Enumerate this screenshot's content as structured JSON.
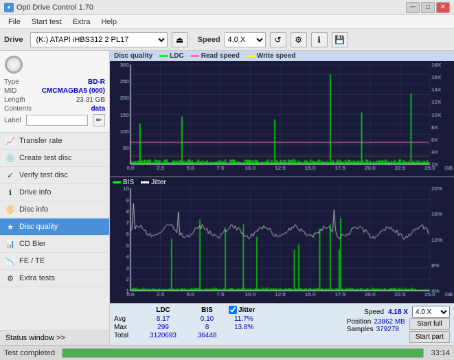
{
  "titlebar": {
    "title": "Opti Drive Control 1.70",
    "icon": "●",
    "minimize": "─",
    "maximize": "□",
    "close": "✕"
  },
  "menubar": {
    "items": [
      "File",
      "Start test",
      "Extra",
      "Help"
    ]
  },
  "toolbar": {
    "drive_label": "Drive",
    "drive_value": "(K:)  ATAPI iHBS312  2 PL17",
    "speed_label": "Speed",
    "speed_value": "4.0 X"
  },
  "sidebar": {
    "disc_type": "BD-R",
    "disc_mid": "CMCMAGBA5 (000)",
    "disc_length": "23.31 GB",
    "disc_contents": "data",
    "disc_label_placeholder": "",
    "nav_items": [
      {
        "id": "transfer-rate",
        "label": "Transfer rate",
        "icon": "📈"
      },
      {
        "id": "create-test-disc",
        "label": "Create test disc",
        "icon": "💿"
      },
      {
        "id": "verify-test-disc",
        "label": "Verify test disc",
        "icon": "✓"
      },
      {
        "id": "drive-info",
        "label": "Drive info",
        "icon": "ℹ"
      },
      {
        "id": "disc-info",
        "label": "Disc info",
        "icon": "📀"
      },
      {
        "id": "disc-quality",
        "label": "Disc quality",
        "icon": "★",
        "active": true
      },
      {
        "id": "cd-bler",
        "label": "CD Bler",
        "icon": "📊"
      },
      {
        "id": "fe-te",
        "label": "FE / TE",
        "icon": "📉"
      },
      {
        "id": "extra-tests",
        "label": "Extra tests",
        "icon": "⚙"
      }
    ],
    "status_window": "Status window >>"
  },
  "chart1": {
    "title": "Disc quality",
    "legend": [
      {
        "label": "LDC",
        "color": "#00ff00"
      },
      {
        "label": "Read speed",
        "color": "#ff69b4"
      },
      {
        "label": "Write speed",
        "color": "#ffff00"
      }
    ],
    "y_axis_left_max": 300,
    "y_axis_right_labels": [
      "18X",
      "16X",
      "14X",
      "12X",
      "10X",
      "8X",
      "6X",
      "4X",
      "2X"
    ],
    "x_axis_max": "25.0 GB",
    "x_ticks": [
      "0.0",
      "2.5",
      "5.0",
      "7.5",
      "10.0",
      "12.5",
      "15.0",
      "17.5",
      "20.0",
      "22.5"
    ]
  },
  "chart2": {
    "legend": [
      {
        "label": "BIS",
        "color": "#00ff00"
      },
      {
        "label": "Jitter",
        "color": "#ffffff"
      }
    ],
    "y_axis_left": {
      "min": 1,
      "max": 10
    },
    "y_axis_right_labels": [
      "20%",
      "16%",
      "12%",
      "8%",
      "4%"
    ],
    "x_ticks": [
      "0.0",
      "2.5",
      "5.0",
      "7.5",
      "10.0",
      "12.5",
      "15.0",
      "17.5",
      "20.0",
      "22.5"
    ],
    "x_max": "25.0 GB"
  },
  "stats": {
    "columns": [
      "LDC",
      "BIS"
    ],
    "jitter_label": "Jitter",
    "jitter_checked": true,
    "speed_label": "Speed",
    "speed_value": "4.18 X",
    "speed_select": "4.0 X",
    "rows": [
      {
        "label": "Avg",
        "ldc": "8.17",
        "bis": "0.10",
        "jitter": "11.7%"
      },
      {
        "label": "Max",
        "ldc": "299",
        "bis": "8",
        "jitter": "13.8%"
      },
      {
        "label": "Total",
        "ldc": "3120693",
        "bis": "36448",
        "jitter": ""
      }
    ],
    "position_label": "Position",
    "position_value": "23862 MB",
    "samples_label": "Samples",
    "samples_value": "379278",
    "start_full": "Start full",
    "start_part": "Start part"
  },
  "statusbar": {
    "status_text": "Test completed",
    "progress": 100,
    "time": "33:14"
  }
}
